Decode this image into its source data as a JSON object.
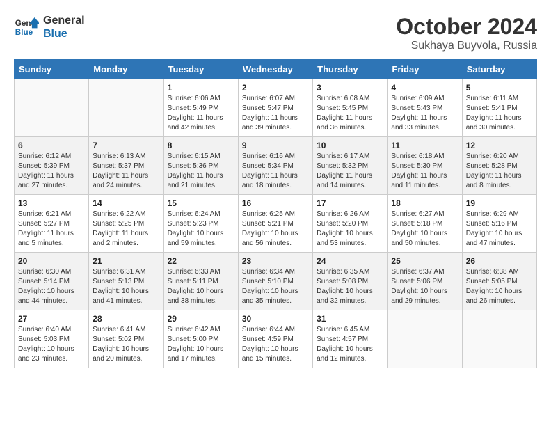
{
  "logo": {
    "line1": "General",
    "line2": "Blue"
  },
  "title": "October 2024",
  "subtitle": "Sukhaya Buyvola, Russia",
  "headers": [
    "Sunday",
    "Monday",
    "Tuesday",
    "Wednesday",
    "Thursday",
    "Friday",
    "Saturday"
  ],
  "weeks": [
    [
      {
        "day": "",
        "sunrise": "",
        "sunset": "",
        "daylight": ""
      },
      {
        "day": "",
        "sunrise": "",
        "sunset": "",
        "daylight": ""
      },
      {
        "day": "1",
        "sunrise": "Sunrise: 6:06 AM",
        "sunset": "Sunset: 5:49 PM",
        "daylight": "Daylight: 11 hours and 42 minutes."
      },
      {
        "day": "2",
        "sunrise": "Sunrise: 6:07 AM",
        "sunset": "Sunset: 5:47 PM",
        "daylight": "Daylight: 11 hours and 39 minutes."
      },
      {
        "day": "3",
        "sunrise": "Sunrise: 6:08 AM",
        "sunset": "Sunset: 5:45 PM",
        "daylight": "Daylight: 11 hours and 36 minutes."
      },
      {
        "day": "4",
        "sunrise": "Sunrise: 6:09 AM",
        "sunset": "Sunset: 5:43 PM",
        "daylight": "Daylight: 11 hours and 33 minutes."
      },
      {
        "day": "5",
        "sunrise": "Sunrise: 6:11 AM",
        "sunset": "Sunset: 5:41 PM",
        "daylight": "Daylight: 11 hours and 30 minutes."
      }
    ],
    [
      {
        "day": "6",
        "sunrise": "Sunrise: 6:12 AM",
        "sunset": "Sunset: 5:39 PM",
        "daylight": "Daylight: 11 hours and 27 minutes."
      },
      {
        "day": "7",
        "sunrise": "Sunrise: 6:13 AM",
        "sunset": "Sunset: 5:37 PM",
        "daylight": "Daylight: 11 hours and 24 minutes."
      },
      {
        "day": "8",
        "sunrise": "Sunrise: 6:15 AM",
        "sunset": "Sunset: 5:36 PM",
        "daylight": "Daylight: 11 hours and 21 minutes."
      },
      {
        "day": "9",
        "sunrise": "Sunrise: 6:16 AM",
        "sunset": "Sunset: 5:34 PM",
        "daylight": "Daylight: 11 hours and 18 minutes."
      },
      {
        "day": "10",
        "sunrise": "Sunrise: 6:17 AM",
        "sunset": "Sunset: 5:32 PM",
        "daylight": "Daylight: 11 hours and 14 minutes."
      },
      {
        "day": "11",
        "sunrise": "Sunrise: 6:18 AM",
        "sunset": "Sunset: 5:30 PM",
        "daylight": "Daylight: 11 hours and 11 minutes."
      },
      {
        "day": "12",
        "sunrise": "Sunrise: 6:20 AM",
        "sunset": "Sunset: 5:28 PM",
        "daylight": "Daylight: 11 hours and 8 minutes."
      }
    ],
    [
      {
        "day": "13",
        "sunrise": "Sunrise: 6:21 AM",
        "sunset": "Sunset: 5:27 PM",
        "daylight": "Daylight: 11 hours and 5 minutes."
      },
      {
        "day": "14",
        "sunrise": "Sunrise: 6:22 AM",
        "sunset": "Sunset: 5:25 PM",
        "daylight": "Daylight: 11 hours and 2 minutes."
      },
      {
        "day": "15",
        "sunrise": "Sunrise: 6:24 AM",
        "sunset": "Sunset: 5:23 PM",
        "daylight": "Daylight: 10 hours and 59 minutes."
      },
      {
        "day": "16",
        "sunrise": "Sunrise: 6:25 AM",
        "sunset": "Sunset: 5:21 PM",
        "daylight": "Daylight: 10 hours and 56 minutes."
      },
      {
        "day": "17",
        "sunrise": "Sunrise: 6:26 AM",
        "sunset": "Sunset: 5:20 PM",
        "daylight": "Daylight: 10 hours and 53 minutes."
      },
      {
        "day": "18",
        "sunrise": "Sunrise: 6:27 AM",
        "sunset": "Sunset: 5:18 PM",
        "daylight": "Daylight: 10 hours and 50 minutes."
      },
      {
        "day": "19",
        "sunrise": "Sunrise: 6:29 AM",
        "sunset": "Sunset: 5:16 PM",
        "daylight": "Daylight: 10 hours and 47 minutes."
      }
    ],
    [
      {
        "day": "20",
        "sunrise": "Sunrise: 6:30 AM",
        "sunset": "Sunset: 5:14 PM",
        "daylight": "Daylight: 10 hours and 44 minutes."
      },
      {
        "day": "21",
        "sunrise": "Sunrise: 6:31 AM",
        "sunset": "Sunset: 5:13 PM",
        "daylight": "Daylight: 10 hours and 41 minutes."
      },
      {
        "day": "22",
        "sunrise": "Sunrise: 6:33 AM",
        "sunset": "Sunset: 5:11 PM",
        "daylight": "Daylight: 10 hours and 38 minutes."
      },
      {
        "day": "23",
        "sunrise": "Sunrise: 6:34 AM",
        "sunset": "Sunset: 5:10 PM",
        "daylight": "Daylight: 10 hours and 35 minutes."
      },
      {
        "day": "24",
        "sunrise": "Sunrise: 6:35 AM",
        "sunset": "Sunset: 5:08 PM",
        "daylight": "Daylight: 10 hours and 32 minutes."
      },
      {
        "day": "25",
        "sunrise": "Sunrise: 6:37 AM",
        "sunset": "Sunset: 5:06 PM",
        "daylight": "Daylight: 10 hours and 29 minutes."
      },
      {
        "day": "26",
        "sunrise": "Sunrise: 6:38 AM",
        "sunset": "Sunset: 5:05 PM",
        "daylight": "Daylight: 10 hours and 26 minutes."
      }
    ],
    [
      {
        "day": "27",
        "sunrise": "Sunrise: 6:40 AM",
        "sunset": "Sunset: 5:03 PM",
        "daylight": "Daylight: 10 hours and 23 minutes."
      },
      {
        "day": "28",
        "sunrise": "Sunrise: 6:41 AM",
        "sunset": "Sunset: 5:02 PM",
        "daylight": "Daylight: 10 hours and 20 minutes."
      },
      {
        "day": "29",
        "sunrise": "Sunrise: 6:42 AM",
        "sunset": "Sunset: 5:00 PM",
        "daylight": "Daylight: 10 hours and 17 minutes."
      },
      {
        "day": "30",
        "sunrise": "Sunrise: 6:44 AM",
        "sunset": "Sunset: 4:59 PM",
        "daylight": "Daylight: 10 hours and 15 minutes."
      },
      {
        "day": "31",
        "sunrise": "Sunrise: 6:45 AM",
        "sunset": "Sunset: 4:57 PM",
        "daylight": "Daylight: 10 hours and 12 minutes."
      },
      {
        "day": "",
        "sunrise": "",
        "sunset": "",
        "daylight": ""
      },
      {
        "day": "",
        "sunrise": "",
        "sunset": "",
        "daylight": ""
      }
    ]
  ]
}
